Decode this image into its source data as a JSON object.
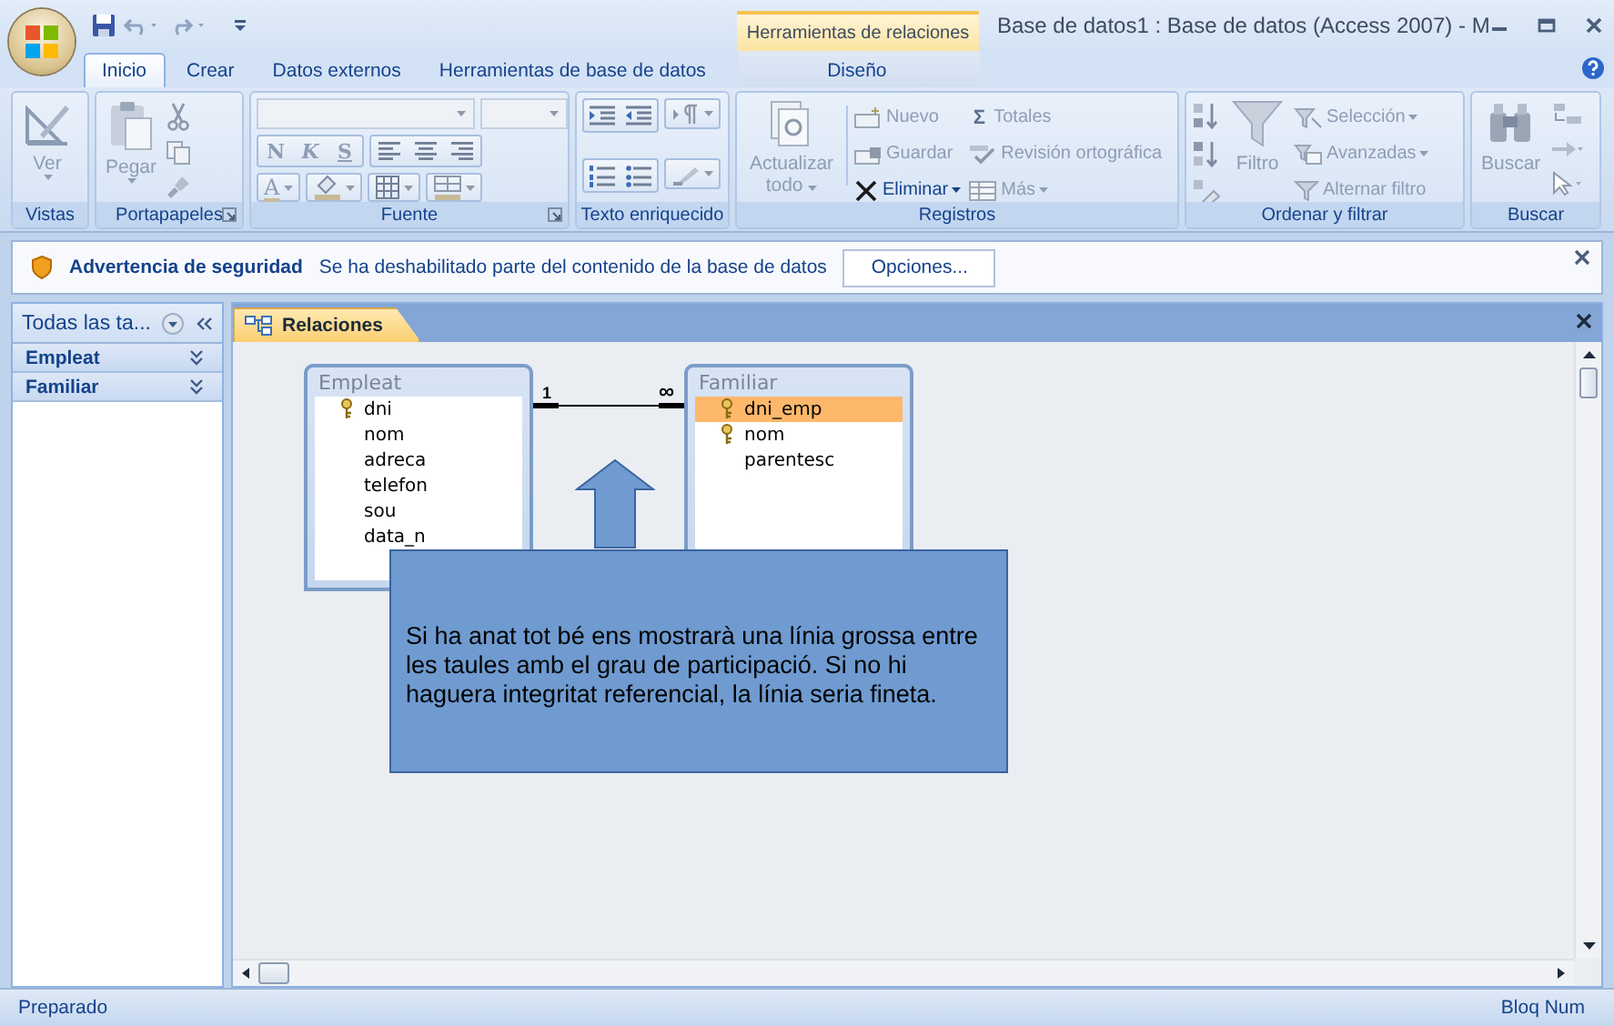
{
  "window": {
    "title": "Base de datos1 : Base de datos (Access 2007) - M"
  },
  "contextual_tab_group": {
    "label": "Herramientas de relaciones"
  },
  "ribbon_tabs": [
    {
      "label": "Inicio",
      "selected": true
    },
    {
      "label": "Crear",
      "selected": false
    },
    {
      "label": "Datos externos",
      "selected": false
    },
    {
      "label": "Herramientas de base de datos",
      "selected": false
    },
    {
      "label": "Diseño",
      "selected": false
    }
  ],
  "ribbon_groups": [
    {
      "label": "Vistas",
      "launcher": false,
      "buttons": [
        {
          "label": "Ver",
          "disabled": true
        }
      ]
    },
    {
      "label": "Portapapeles",
      "launcher": true,
      "buttons": [
        {
          "label": "Pegar",
          "disabled": true
        }
      ]
    },
    {
      "label": "Fuente",
      "launcher": true,
      "buttons": [
        {
          "label": "N",
          "disabled": true
        },
        {
          "label": "K",
          "disabled": true
        },
        {
          "label": "S",
          "disabled": true
        },
        {
          "label": "A",
          "disabled": true
        }
      ]
    },
    {
      "label": "Texto enriquecido",
      "launcher": false
    },
    {
      "label": "Registros",
      "launcher": false,
      "buttons": [
        {
          "label": "Actualizar todo",
          "disabled": true
        },
        {
          "label": "Nuevo",
          "disabled": true
        },
        {
          "label": "Guardar",
          "disabled": true
        },
        {
          "label": "Eliminar",
          "disabled": false
        },
        {
          "label": "Totales",
          "glyph": "Σ",
          "disabled": true
        },
        {
          "label": "Revisión ortográfica",
          "disabled": true
        },
        {
          "label": "Más",
          "disabled": true
        }
      ]
    },
    {
      "label": "Ordenar y filtrar",
      "launcher": false,
      "buttons": [
        {
          "label": "Filtro",
          "disabled": true
        },
        {
          "label": "Selección",
          "disabled": true
        },
        {
          "label": "Avanzadas",
          "disabled": true
        },
        {
          "label": "Alternar filtro",
          "disabled": true
        }
      ]
    },
    {
      "label": "Buscar",
      "launcher": false,
      "buttons": [
        {
          "label": "Buscar",
          "disabled": true
        }
      ]
    }
  ],
  "security_bar": {
    "title": "Advertencia de seguridad",
    "message": "Se ha deshabilitado parte del contenido de la base de datos",
    "button": "Opciones..."
  },
  "nav_pane": {
    "header": "Todas las ta...",
    "groups": [
      {
        "label": "Empleat",
        "expanded": false
      },
      {
        "label": "Familiar",
        "expanded": false
      }
    ]
  },
  "document_tabs": [
    {
      "label": "Relaciones",
      "selected": true
    }
  ],
  "tables": [
    {
      "name": "Empleat",
      "fields": [
        {
          "name": "dni",
          "key": true,
          "selected": false
        },
        {
          "name": "nom",
          "key": false,
          "selected": false
        },
        {
          "name": "adreca",
          "key": false,
          "selected": false
        },
        {
          "name": "telefon",
          "key": false,
          "selected": false
        },
        {
          "name": "sou",
          "key": false,
          "selected": false
        },
        {
          "name": "data_n",
          "key": false,
          "selected": false
        }
      ]
    },
    {
      "name": "Familiar",
      "fields": [
        {
          "name": "dni_emp",
          "key": true,
          "selected": true
        },
        {
          "name": "nom",
          "key": true,
          "selected": false
        },
        {
          "name": "parentesc",
          "key": false,
          "selected": false
        }
      ]
    }
  ],
  "relationship": {
    "one_label": "1",
    "many_label": "∞",
    "enforced": true
  },
  "callout": {
    "text": "Si ha anat tot bé ens mostrarà una línia grossa entre les taules amb el grau de participació. Si no hi haguera integritat referencial, la línia seria fineta."
  },
  "status_bar": {
    "left": "Preparado",
    "right": "Bloq Num"
  }
}
